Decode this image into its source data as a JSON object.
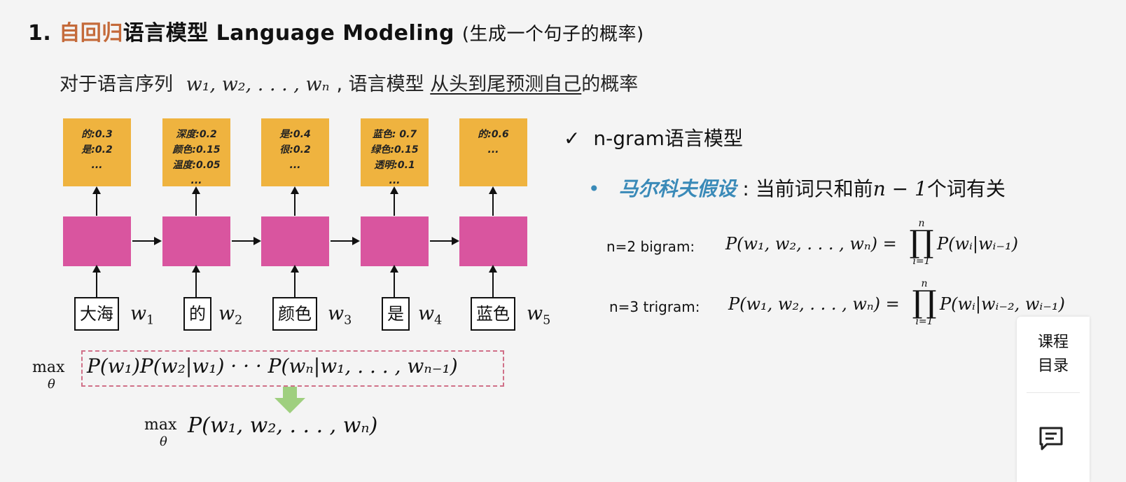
{
  "title": {
    "number": "1.",
    "accent": "自回归",
    "rest": "语言模型 Language Modeling",
    "paren": "(生成一个句子的概率)"
  },
  "subtitle": {
    "prefix": "对于语言序列",
    "sequence": "w₁, w₂, . . . , wₙ",
    "middle": ", 语言模型",
    "underlined": "从头到尾预测自己",
    "suffix": "的概率"
  },
  "diagram": {
    "outputs": [
      [
        "的:0.3",
        "是:0.2",
        "..."
      ],
      [
        "深度:0.2",
        "颜色:0.15",
        "温度:0.05",
        "..."
      ],
      [
        "是:0.4",
        "很:0.2",
        "..."
      ],
      [
        "蓝色: 0.7",
        "绿色:0.15",
        "透明:0.1",
        "..."
      ],
      [
        "的:0.6",
        "..."
      ]
    ],
    "inputs": [
      "大海",
      "的",
      "颜色",
      "是",
      "蓝色"
    ],
    "vars": [
      "w",
      "w",
      "w",
      "w",
      "w"
    ],
    "var_subs": [
      "1",
      "2",
      "3",
      "4",
      "5"
    ],
    "arrow_color": "#9fcf7f"
  },
  "max_formula": {
    "op": "max",
    "theta": "θ",
    "chain": "P(w₁)P(w₂|w₁) · · · P(wₙ|w₁, . . . , wₙ₋₁)",
    "joint": "P(w₁, w₂, . . . , wₙ)"
  },
  "right": {
    "check": "✓",
    "ngram_title": "n-gram语言模型",
    "bullet": "•",
    "markov_term": "马尔科夫假设",
    "markov_sep": ":",
    "markov_text_a": "当前词只和前",
    "markov_math": "n − 1",
    "markov_text_b": "个词有关",
    "bigram_label": "n=2 bigram:",
    "bigram_lhs": "P(w₁, w₂, . . . , wₙ) =",
    "bigram_rhs": "P(wᵢ|wᵢ₋₁)",
    "trigram_label": "n=3 trigram:",
    "trigram_lhs": "P(w₁, w₂, . . . , wₙ) =",
    "trigram_rhs": "P(wᵢ|wᵢ₋₂, wᵢ₋₁)",
    "prod_upper": "n",
    "prod_lower": "i=1",
    "prod_symbol": "∏"
  },
  "side_panel": {
    "line1": "课程",
    "line2": "目录",
    "chat_icon": "chat-icon"
  },
  "colors": {
    "accent": "#c46a3a",
    "output_box": "#efb33f",
    "rnn_box": "#d9559f",
    "markov": "#3a8ab8",
    "dashed": "#d07088"
  }
}
